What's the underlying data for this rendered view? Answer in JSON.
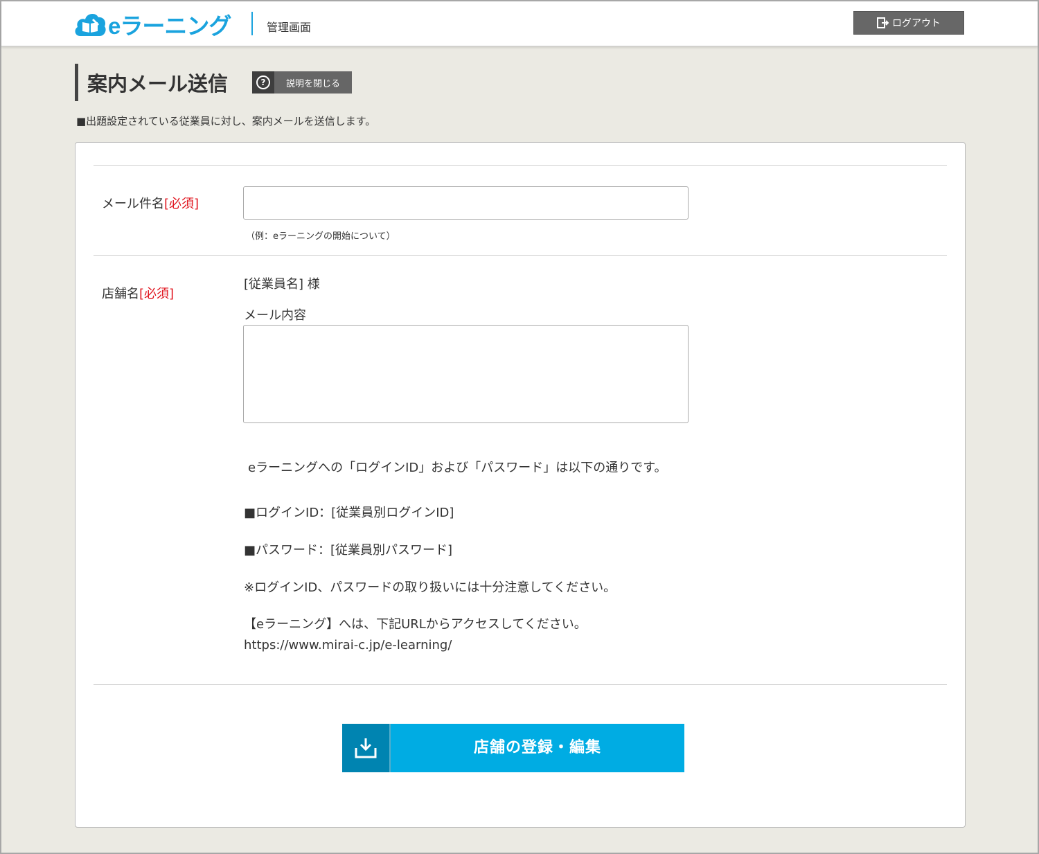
{
  "header": {
    "logo_text": "eラーニング",
    "admin_label": "管理画面",
    "logout_label": "ログアウト"
  },
  "page": {
    "title": "案内メール送信",
    "help_label": "説明を閉じる",
    "help_glyph": "?",
    "description": "■出題設定されている従業員に対し、案内メールを送信します。"
  },
  "form": {
    "subject_label": "メール件名",
    "subject_required": "[必須]",
    "subject_value": "",
    "subject_hint": "（例：eラーニングの開始について）",
    "store_label": "店舗名",
    "store_required": "[必須]",
    "salutation": "[従業員名] 様",
    "body_label": "メール内容",
    "body_value": "",
    "fixed_lines": {
      "intro": "eラーニングへの「ログインID」および「パスワード」は以下の通りです。",
      "login_id": "■ログインID：[従業員別ログインID]",
      "password": "■パスワード：[従業員別パスワード]",
      "caution": "※ログインID、パスワードの取り扱いには十分注意してください。",
      "access": "【eラーニング】へは、下記URLからアクセスしてください。",
      "url": "https://www.mirai-c.jp/e-learning/"
    },
    "submit_label": "店舗の登録・編集"
  },
  "colors": {
    "brand": "#1aa3de",
    "required": "#e0141e",
    "submit": "#00ace3",
    "submit_icon_bg": "#0084b1",
    "page_bg": "#ebeae3"
  },
  "icons": {
    "logo": "cloud-book-icon",
    "logout": "logout-icon",
    "help": "question-circle-icon",
    "submit": "download-tray-icon"
  }
}
